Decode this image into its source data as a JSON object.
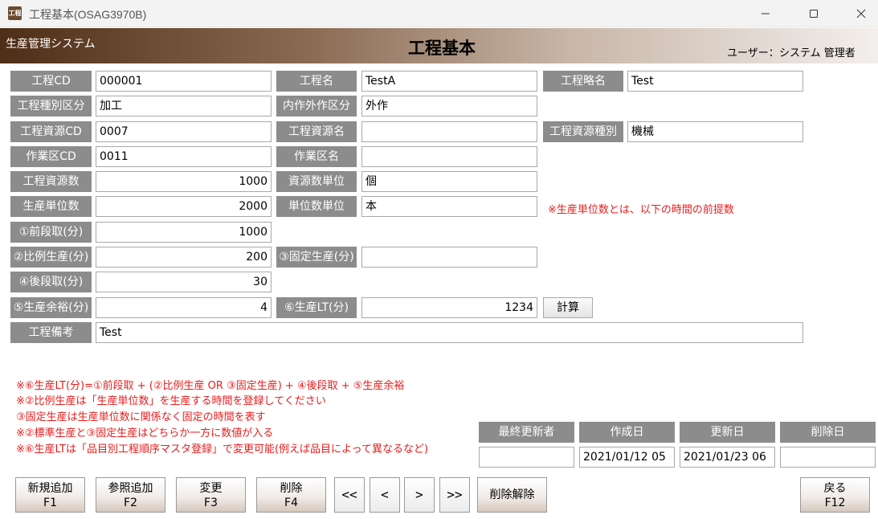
{
  "window": {
    "title": "工程基本(OSAG3970B)",
    "icon_text": "工程"
  },
  "header": {
    "system_name": "生産管理システム",
    "page_title": "工程基本",
    "user_label": "ユーザー：",
    "user_name": "システム 管理者"
  },
  "form": {
    "process_cd": {
      "label": "工程CD",
      "value": "000001"
    },
    "process_name": {
      "label": "工程名",
      "value": "TestA"
    },
    "process_short_name": {
      "label": "工程略名",
      "value": "Test"
    },
    "process_type": {
      "label": "工程種別区分",
      "value": "加工"
    },
    "inhouse_outsource": {
      "label": "内作外作区分",
      "value": "外作"
    },
    "resource_cd": {
      "label": "工程資源CD",
      "value": "0007"
    },
    "resource_name": {
      "label": "工程資源名",
      "value": ""
    },
    "resource_type": {
      "label": "工程資源種別",
      "value": "機械"
    },
    "work_area_cd": {
      "label": "作業区CD",
      "value": "0011"
    },
    "work_area_name": {
      "label": "作業区名",
      "value": ""
    },
    "resource_count": {
      "label": "工程資源数",
      "value": "1000"
    },
    "resource_unit": {
      "label": "資源数単位",
      "value": "個"
    },
    "production_unit_count": {
      "label": "生産単位数",
      "value": "2000"
    },
    "unit_count_unit": {
      "label": "単位数単位",
      "value": "本"
    },
    "production_unit_note": "※生産単位数とは、以下の時間の前提数",
    "pre_setup": {
      "label": "①前段取(分)",
      "value": "1000"
    },
    "proportional_production": {
      "label": "②比例生産(分)",
      "value": "200"
    },
    "fixed_production": {
      "label": "③固定生産(分)",
      "value": ""
    },
    "post_setup": {
      "label": "④後段取(分)",
      "value": "30"
    },
    "production_margin": {
      "label": "⑤生産余裕(分)",
      "value": "4"
    },
    "production_lt": {
      "label": "⑥生産LT(分)",
      "value": "1234"
    },
    "calc_button": "計算",
    "remarks": {
      "label": "工程備考",
      "value": "Test"
    }
  },
  "notes": [
    "※⑥生産LT(分)=①前段取 + (②比例生産 OR ③固定生産) + ④後段取 + ⑤生産余裕",
    "※②比例生産は「生産単位数」を生産する時間を登録してください",
    "③固定生産は生産単位数に関係なく固定の時間を表す",
    "※②標準生産と③固定生産はどちらか一方に数値が入る",
    "※⑥生産LTは「品目別工程順序マスタ登録」で変更可能(例えば品目によって異なるなど)"
  ],
  "audit": {
    "last_updater": {
      "label": "最終更新者",
      "value": ""
    },
    "created": {
      "label": "作成日",
      "value": "2021/01/12 05"
    },
    "updated": {
      "label": "更新日",
      "value": "2021/01/23 06"
    },
    "deleted": {
      "label": "削除日",
      "value": ""
    }
  },
  "buttons": {
    "new": {
      "label": "新規追加",
      "key": "F1"
    },
    "ref_add": {
      "label": "参照追加",
      "key": "F2"
    },
    "change": {
      "label": "変更",
      "key": "F3"
    },
    "delete": {
      "label": "削除",
      "key": "F4"
    },
    "first": "<<",
    "prev": "<",
    "next": ">",
    "last": ">>",
    "undelete": "削除解除",
    "back": {
      "label": "戻る",
      "key": "F12"
    }
  },
  "colors": {
    "label_bg": "#8c8c8c",
    "note_red": "#e81c1c",
    "header_dark": "#4e2e16"
  }
}
